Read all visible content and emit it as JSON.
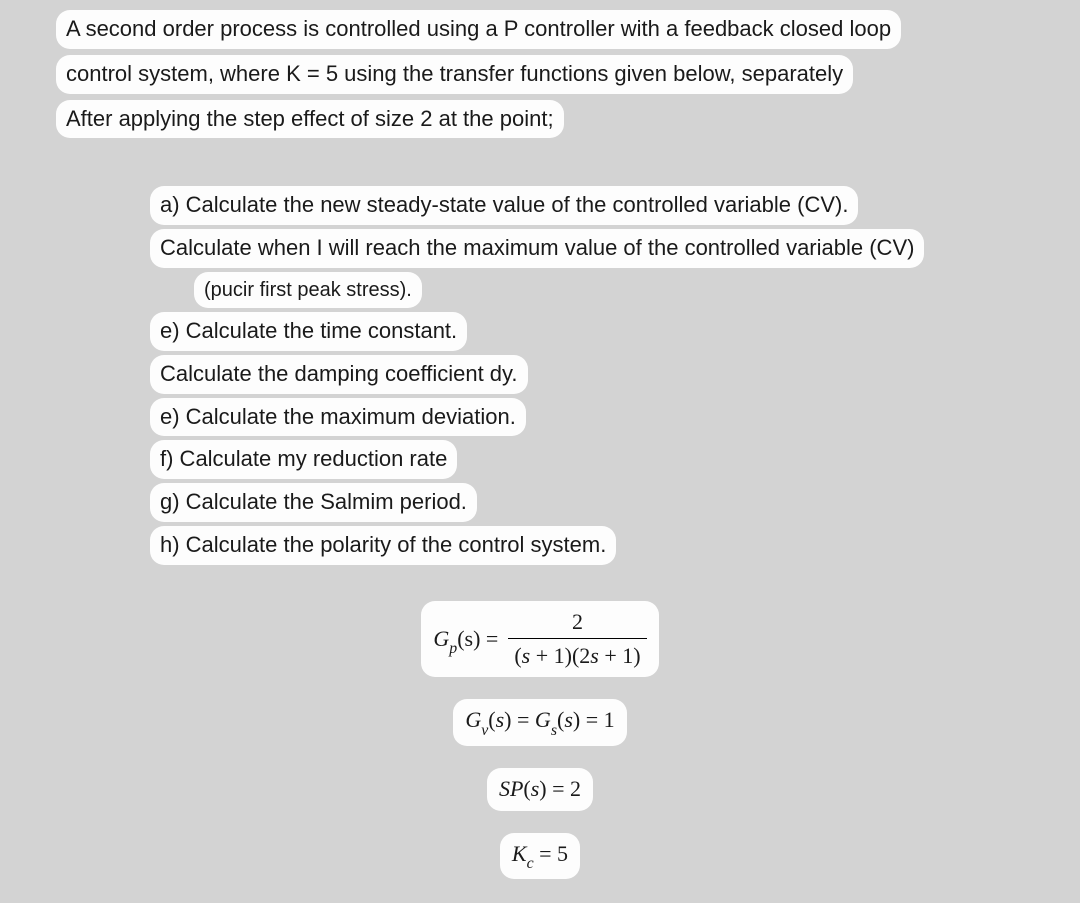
{
  "intro": {
    "line1": "A second order process is controlled using a P controller with a feedback closed loop",
    "line2": "control system, where K = 5 using the transfer functions given below, separately",
    "line3": "After applying the step effect of size 2 at the point;"
  },
  "questions": {
    "a1": "a) Calculate the new steady-state value of the controlled variable (CV).",
    "a2": "Calculate when I will reach the maximum value of the controlled variable (CV)",
    "note": "(pucir first peak stress).",
    "e1": "e) Calculate the time constant.",
    "d": "Calculate the damping coefficient dy.",
    "e2": "e) Calculate the maximum deviation.",
    "f": "f) Calculate my reduction rate",
    "g": "g) Calculate the Salmim period.",
    "h": "h) Calculate the polarity of the control system."
  },
  "formulas": {
    "gp_left": "G",
    "gp_sub": "p",
    "gp_paren_s_eq": "(s) =",
    "gp_num": "2",
    "gp_den": "(s + 1)(2s + 1)",
    "gv_label_G": "G",
    "gv_sub_v": "v",
    "gv_sub_s": "s",
    "s_paren": "(s)",
    "eq_one": " = 1",
    "eq_sign": " = ",
    "sp_text": "SP(s) = 2",
    "kc_G": "K",
    "kc_sub": "c",
    "kc_right": " = 5"
  }
}
